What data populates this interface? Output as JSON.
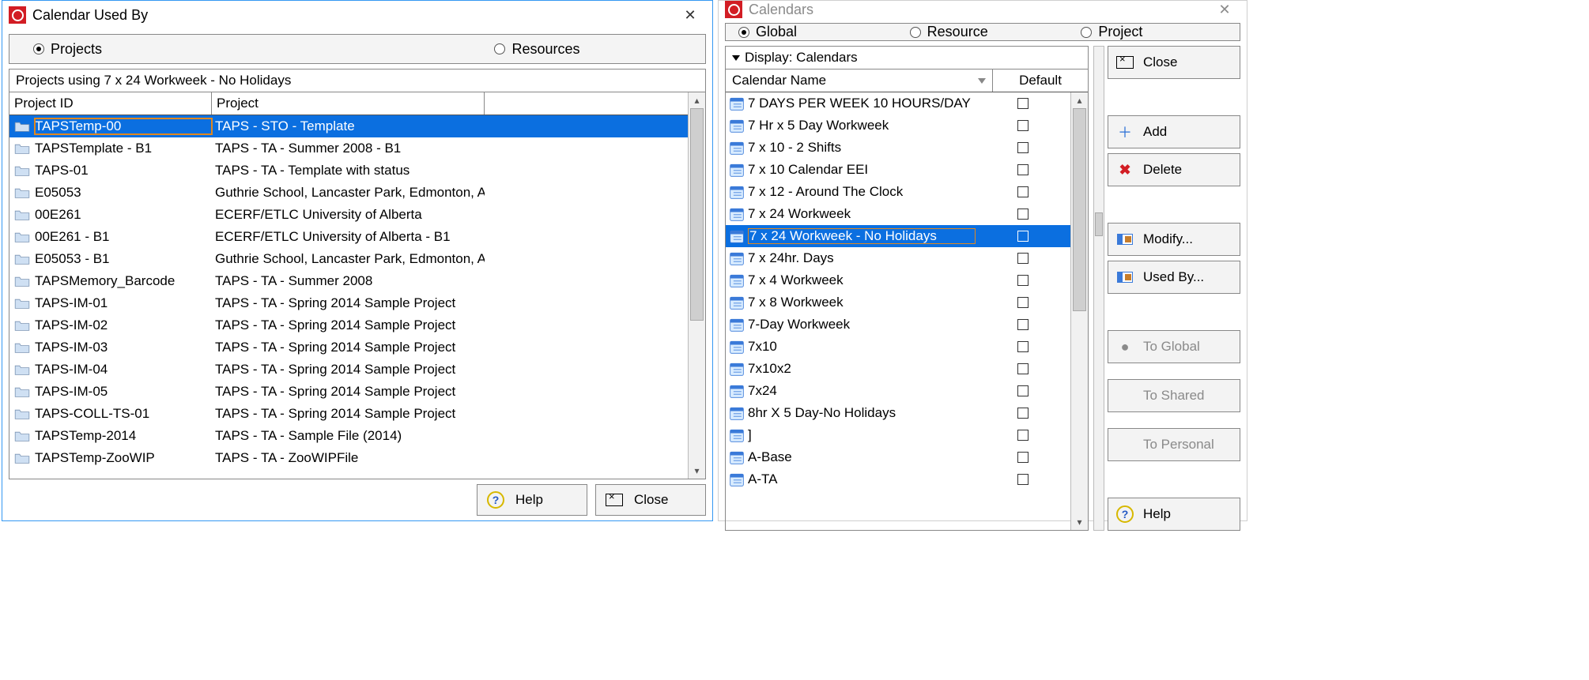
{
  "left": {
    "title": "Calendar Used By",
    "radios": {
      "projects": "Projects",
      "resources": "Resources"
    },
    "subheader": "Projects using 7 x 24 Workweek - No Holidays",
    "columns": {
      "id": "Project ID",
      "project": "Project"
    },
    "rows": [
      {
        "id": "TAPSTemp-00",
        "project": "TAPS - STO - Template",
        "selected": true
      },
      {
        "id": "TAPSTemplate - B1",
        "project": "TAPS - TA - Summer 2008 - B1"
      },
      {
        "id": "TAPS-01",
        "project": "TAPS - TA - Template with status"
      },
      {
        "id": "E05053",
        "project": "Guthrie School, Lancaster Park, Edmonton, A"
      },
      {
        "id": "00E261",
        "project": "ECERF/ETLC University of Alberta"
      },
      {
        "id": "00E261 - B1",
        "project": "ECERF/ETLC University of Alberta - B1"
      },
      {
        "id": "E05053 - B1",
        "project": "Guthrie School, Lancaster Park, Edmonton, A"
      },
      {
        "id": "TAPSMemory_Barcode",
        "project": "TAPS - TA - Summer 2008"
      },
      {
        "id": "TAPS-IM-01",
        "project": "TAPS - TA - Spring 2014 Sample Project"
      },
      {
        "id": "TAPS-IM-02",
        "project": "TAPS - TA - Spring 2014 Sample Project"
      },
      {
        "id": "TAPS-IM-03",
        "project": "TAPS - TA - Spring 2014 Sample Project"
      },
      {
        "id": "TAPS-IM-04",
        "project": "TAPS - TA - Spring 2014 Sample Project"
      },
      {
        "id": "TAPS-IM-05",
        "project": "TAPS - TA - Spring 2014 Sample Project"
      },
      {
        "id": "TAPS-COLL-TS-01",
        "project": "TAPS - TA - Spring 2014 Sample Project"
      },
      {
        "id": "TAPSTemp-2014",
        "project": "TAPS - TA - Sample File (2014)"
      },
      {
        "id": "TAPSTemp-ZooWIP",
        "project": "TAPS - TA - ZooWIPFile"
      }
    ],
    "buttons": {
      "help": "Help",
      "close": "Close"
    }
  },
  "right": {
    "title": "Calendars",
    "radios": {
      "global": "Global",
      "resource": "Resource",
      "project": "Project"
    },
    "display_label": "Display: Calendars",
    "columns": {
      "name": "Calendar Name",
      "default": "Default"
    },
    "rows": [
      {
        "name": "7 DAYS PER WEEK 10 HOURS/DAY"
      },
      {
        "name": "7 Hr x 5 Day Workweek"
      },
      {
        "name": "7 x 10 - 2 Shifts"
      },
      {
        "name": "7 x 10 Calendar EEI"
      },
      {
        "name": "7 x 12 - Around The Clock"
      },
      {
        "name": "7 x 24 Workweek"
      },
      {
        "name": "7 x 24 Workweek - No Holidays",
        "selected": true
      },
      {
        "name": "7 x 24hr. Days"
      },
      {
        "name": "7 x 4 Workweek"
      },
      {
        "name": "7 x 8 Workweek"
      },
      {
        "name": "7-Day Workweek"
      },
      {
        "name": "7x10"
      },
      {
        "name": "7x10x2"
      },
      {
        "name": "7x24"
      },
      {
        "name": "8hr X 5 Day-No Holidays"
      },
      {
        "name": "]"
      },
      {
        "name": "A-Base"
      },
      {
        "name": "A-TA"
      }
    ],
    "actions": {
      "close": "Close",
      "add": "Add",
      "delete": "Delete",
      "modify": "Modify...",
      "used_by": "Used By...",
      "to_global": "To Global",
      "to_shared": "To Shared",
      "to_personal": "To Personal",
      "help": "Help"
    }
  }
}
